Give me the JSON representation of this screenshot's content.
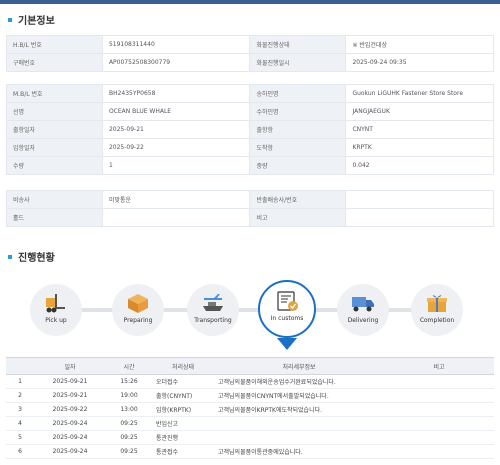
{
  "basic": {
    "title": "기본정보",
    "rows1": [
      {
        "l1": "H.B/L 번호",
        "v1": "519108311440",
        "l2": "화물진행상태",
        "v2": "※ 반입건대상"
      },
      {
        "l1": "구매번호",
        "v1": "AP00752508300779",
        "l2": "화물진행일시",
        "v2": "2025-09-24 09:35"
      }
    ],
    "rows2": [
      {
        "l1": "M.B/L 번호",
        "v1": "BH2435YP0658",
        "l2": "송하인명",
        "v2": "Guokun LiGUHK Fastener Store Store"
      },
      {
        "l1": "선명",
        "v1": "OCEAN BLUE WHALE",
        "l2": "수하인명",
        "v2": "JANGJAEGUK"
      },
      {
        "l1": "출항일자",
        "v1": "2025-09-21",
        "l2": "출항항",
        "v2": "CNYNT"
      },
      {
        "l1": "입항일자",
        "v1": "2025-09-22",
        "l2": "도착항",
        "v2": "KRPTK"
      },
      {
        "l1": "수량",
        "v1": "1",
        "l2": "중량",
        "v2": "0.042"
      }
    ],
    "rows3": [
      {
        "l1": "비송사",
        "v1": "미맞통운",
        "l2": "반출배송사/번호",
        "v2": ""
      },
      {
        "l1": "홀드",
        "v1": "",
        "l2": "비고",
        "v2": ""
      }
    ]
  },
  "progress": {
    "title": "진행현황",
    "steps": [
      {
        "label": "Pick up",
        "icon": "forklift-icon"
      },
      {
        "label": "Preparing",
        "icon": "box-icon"
      },
      {
        "label": "Transporting",
        "icon": "airplane-ship-icon"
      },
      {
        "label": "In customs",
        "icon": "customs-document-icon"
      },
      {
        "label": "Delivering",
        "icon": "truck-icon"
      },
      {
        "label": "Completion",
        "icon": "gift-icon"
      }
    ],
    "active_step": "In customs"
  },
  "history": {
    "headers": [
      "",
      "일자",
      "시간",
      "처리상태",
      "처리세부정보",
      "비고"
    ],
    "rows": [
      {
        "no": "1",
        "date": "2025-09-21",
        "time": "15:26",
        "status": "오더접수",
        "detail": "고객님의물품이해외운송업수거완료되었습니다.",
        "note": ""
      },
      {
        "no": "2",
        "date": "2025-09-21",
        "time": "19:00",
        "status": "출항(CNYNT)",
        "detail": "고객님의물품이CNYNT에서출발되었습니다.",
        "note": ""
      },
      {
        "no": "3",
        "date": "2025-09-22",
        "time": "13:00",
        "status": "입항(KRPTK)",
        "detail": "고객님의물품이KRPTK에도착되었습니다.",
        "note": ""
      },
      {
        "no": "4",
        "date": "2025-09-24",
        "time": "09:25",
        "status": "반입신고",
        "detail": "",
        "note": ""
      },
      {
        "no": "5",
        "date": "2025-09-24",
        "time": "09:25",
        "status": "통관진행",
        "detail": "",
        "note": ""
      },
      {
        "no": "6",
        "date": "2025-09-24",
        "time": "09:25",
        "status": "통관접수",
        "detail": "고객님의물품이통관중에있습니다.",
        "note": ""
      }
    ]
  },
  "colors": {
    "accent": "#1b6fc4",
    "header_bg": "#eef1f5",
    "dot": "#2f9bd3"
  }
}
